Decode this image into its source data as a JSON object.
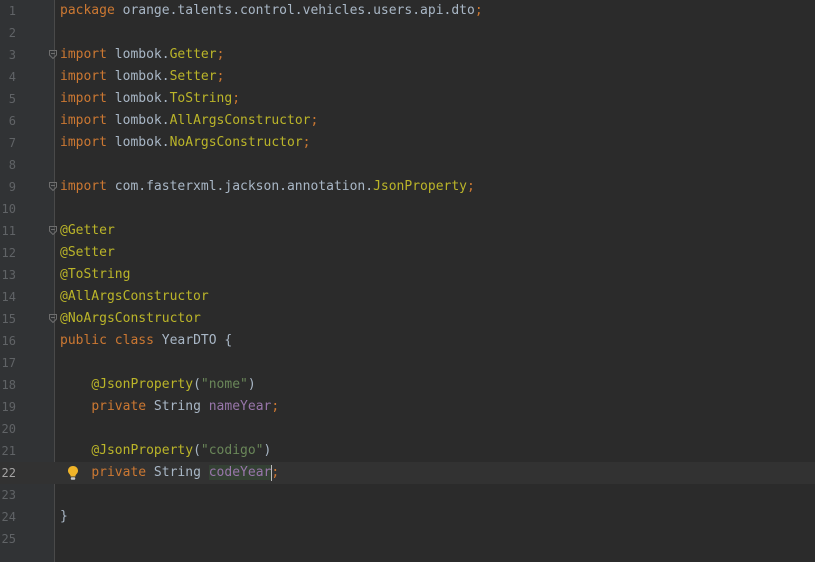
{
  "editor": {
    "current_line": 22,
    "lines": [
      {
        "n": "1",
        "tokens": [
          {
            "t": "package",
            "c": "kw"
          },
          {
            "t": " orange.talents.control.vehicles.users.api.dto",
            "c": "ident"
          },
          {
            "t": ";",
            "c": "semi"
          }
        ]
      },
      {
        "n": "2",
        "tokens": []
      },
      {
        "n": "3",
        "fold": true,
        "tokens": [
          {
            "t": "import",
            "c": "kw"
          },
          {
            "t": " lombok.",
            "c": "ident"
          },
          {
            "t": "Getter",
            "c": "ann"
          },
          {
            "t": ";",
            "c": "semi"
          }
        ]
      },
      {
        "n": "4",
        "tokens": [
          {
            "t": "import",
            "c": "kw"
          },
          {
            "t": " lombok.",
            "c": "ident"
          },
          {
            "t": "Setter",
            "c": "ann"
          },
          {
            "t": ";",
            "c": "semi"
          }
        ]
      },
      {
        "n": "5",
        "tokens": [
          {
            "t": "import",
            "c": "kw"
          },
          {
            "t": " lombok.",
            "c": "ident"
          },
          {
            "t": "ToString",
            "c": "ann"
          },
          {
            "t": ";",
            "c": "semi"
          }
        ]
      },
      {
        "n": "6",
        "tokens": [
          {
            "t": "import",
            "c": "kw"
          },
          {
            "t": " lombok.",
            "c": "ident"
          },
          {
            "t": "AllArgsConstructor",
            "c": "ann"
          },
          {
            "t": ";",
            "c": "semi"
          }
        ]
      },
      {
        "n": "7",
        "tokens": [
          {
            "t": "import",
            "c": "kw"
          },
          {
            "t": " lombok.",
            "c": "ident"
          },
          {
            "t": "NoArgsConstructor",
            "c": "ann"
          },
          {
            "t": ";",
            "c": "semi"
          }
        ]
      },
      {
        "n": "8",
        "tokens": []
      },
      {
        "n": "9",
        "fold": true,
        "tokens": [
          {
            "t": "import",
            "c": "kw"
          },
          {
            "t": " com.fasterxml.jackson.annotation.",
            "c": "ident"
          },
          {
            "t": "JsonProperty",
            "c": "ann"
          },
          {
            "t": ";",
            "c": "semi"
          }
        ]
      },
      {
        "n": "10",
        "tokens": []
      },
      {
        "n": "11",
        "fold": true,
        "tokens": [
          {
            "t": "@Getter",
            "c": "ann"
          }
        ]
      },
      {
        "n": "12",
        "tokens": [
          {
            "t": "@Setter",
            "c": "ann"
          }
        ]
      },
      {
        "n": "13",
        "tokens": [
          {
            "t": "@ToString",
            "c": "ann"
          }
        ]
      },
      {
        "n": "14",
        "tokens": [
          {
            "t": "@AllArgsConstructor",
            "c": "ann"
          }
        ]
      },
      {
        "n": "15",
        "fold": true,
        "tokens": [
          {
            "t": "@NoArgsConstructor",
            "c": "ann"
          }
        ]
      },
      {
        "n": "16",
        "tokens": [
          {
            "t": "public",
            "c": "kw"
          },
          {
            "t": " ",
            "c": "ident"
          },
          {
            "t": "class",
            "c": "kw"
          },
          {
            "t": " YearDTO {",
            "c": "ident"
          }
        ]
      },
      {
        "n": "17",
        "tokens": []
      },
      {
        "n": "18",
        "tokens": [
          {
            "t": "    ",
            "c": "ident"
          },
          {
            "t": "@JsonProperty",
            "c": "ann"
          },
          {
            "t": "(",
            "c": "ident"
          },
          {
            "t": "\"nome\"",
            "c": "str"
          },
          {
            "t": ")",
            "c": "ident"
          }
        ]
      },
      {
        "n": "19",
        "tokens": [
          {
            "t": "    ",
            "c": "ident"
          },
          {
            "t": "private",
            "c": "kw"
          },
          {
            "t": " String ",
            "c": "ident"
          },
          {
            "t": "nameYear",
            "c": "fld"
          },
          {
            "t": ";",
            "c": "semi"
          }
        ]
      },
      {
        "n": "20",
        "tokens": []
      },
      {
        "n": "21",
        "tokens": [
          {
            "t": "    ",
            "c": "ident"
          },
          {
            "t": "@JsonProperty",
            "c": "ann"
          },
          {
            "t": "(",
            "c": "ident"
          },
          {
            "t": "\"codigo\"",
            "c": "str"
          },
          {
            "t": ")",
            "c": "ident"
          }
        ]
      },
      {
        "n": "22",
        "bulb": true,
        "tokens": [
          {
            "t": "    ",
            "c": "ident"
          },
          {
            "t": "private",
            "c": "kw"
          },
          {
            "t": " String ",
            "c": "ident"
          },
          {
            "t": "codeYear",
            "c": "fld hl",
            "caret": true
          },
          {
            "t": ";",
            "c": "semi"
          }
        ]
      },
      {
        "n": "23",
        "tokens": []
      },
      {
        "n": "24",
        "tokens": [
          {
            "t": "}",
            "c": "ident"
          }
        ]
      },
      {
        "n": "25",
        "tokens": []
      }
    ]
  },
  "icons": {
    "fold": "fold-marker-icon",
    "bulb": "lightbulb-icon"
  },
  "colors": {
    "background": "#2b2b2b",
    "gutter": "#313335",
    "keyword": "#cc7832",
    "annotation": "#bbb529",
    "string": "#6a8759",
    "field": "#9876aa",
    "text": "#a9b7c6",
    "line_number": "#606366",
    "bulb": "#f0b429"
  }
}
